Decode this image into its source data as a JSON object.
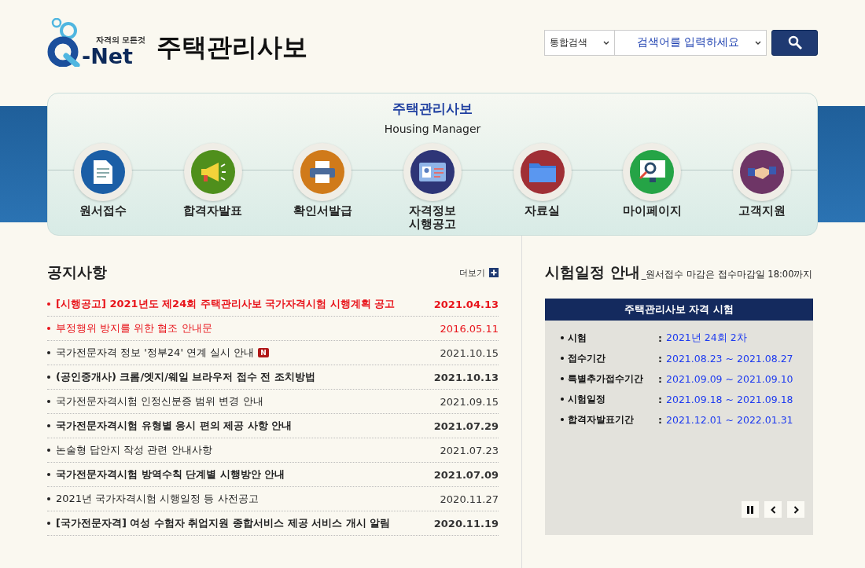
{
  "header": {
    "logo": {
      "tagline": "자격의 모든것",
      "wordmark": "-Net"
    },
    "site_title": "주택관리사보",
    "search": {
      "scope": "통합검색",
      "keyword": "검색어를 입력하세요"
    }
  },
  "banner": {
    "title": "주택관리사보",
    "subtitle": "Housing Manager",
    "menu": [
      {
        "label": "원서접수",
        "kind": "document",
        "color": "#1b5ea6"
      },
      {
        "label": "합격자발표",
        "kind": "megaphone",
        "color": "#4f8f1c"
      },
      {
        "label": "확인서발급",
        "kind": "printer",
        "color": "#d07a1a"
      },
      {
        "label": "자격정보\n시행공고",
        "kind": "idcard",
        "color": "#2e3577"
      },
      {
        "label": "자료실",
        "kind": "folder",
        "color": "#a02f35"
      },
      {
        "label": "마이페이지",
        "kind": "monitor",
        "color": "#25a446"
      },
      {
        "label": "고객지원",
        "kind": "handshake",
        "color": "#6e3566"
      }
    ]
  },
  "notices": {
    "title": "공지사항",
    "more": "더보기",
    "items": [
      {
        "text": "[시행공고] 2021년도 제24회 주택관리사보 국가자격시험 시행계획 공고",
        "date": "2021.04.13",
        "highlighted": true,
        "bold": true
      },
      {
        "text": "부정행위 방지를 위한 협조 안내문",
        "date": "2016.05.11",
        "highlighted": true,
        "bold": false
      },
      {
        "text": "국가전문자격 정보 '정부24' 연계 실시 안내",
        "date": "2021.10.15",
        "highlighted": false,
        "bold": false,
        "badge": "N"
      },
      {
        "text": "(공인중개사) 크롬/엣지/웨일 브라우저 접수 전 조치방법",
        "date": "2021.10.13",
        "highlighted": false,
        "bold": true
      },
      {
        "text": "국가전문자격시험 인정신분증 범위 변경 안내",
        "date": "2021.09.15",
        "highlighted": false,
        "bold": false
      },
      {
        "text": "국가전문자격시험 유형별 응시 편의 제공 사항 안내",
        "date": "2021.07.29",
        "highlighted": false,
        "bold": true
      },
      {
        "text": "논술형 답안지 작성 관련 안내사항",
        "date": "2021.07.23",
        "highlighted": false,
        "bold": false
      },
      {
        "text": "국가전문자격시험 방역수칙 단계별 시행방안 안내",
        "date": "2021.07.09",
        "highlighted": false,
        "bold": true
      },
      {
        "text": "2021년 국가자격시험 시행일정 등 사전공고",
        "date": "2020.11.27",
        "highlighted": false,
        "bold": false
      },
      {
        "text": "[국가전문자격] 여성 수험자 취업지원 종합서비스 제공 서비스 개시 알림",
        "date": "2020.11.19",
        "highlighted": false,
        "bold": true
      }
    ]
  },
  "schedule": {
    "title": "시험일정 안내",
    "note": "_원서접수 마감은 접수마감일 18:00까지",
    "card_title": "주택관리사보 자격 시험",
    "rows": [
      {
        "label": "시험",
        "separator": ":",
        "value": "2021년 24회 2차"
      },
      {
        "label": "접수기간",
        "separator": ":",
        "value": "2021.08.23 ~ 2021.08.27"
      },
      {
        "label": "특별추가접수기간",
        "separator": ":",
        "value": "2021.09.09 ~ 2021.09.10"
      },
      {
        "label": "시험일정",
        "separator": ":",
        "value": "2021.09.18 ~ 2021.09.18"
      },
      {
        "label": "합격자발표기간",
        "separator": ":",
        "value": "2021.12.01 ~ 2022.01.31"
      }
    ]
  }
}
